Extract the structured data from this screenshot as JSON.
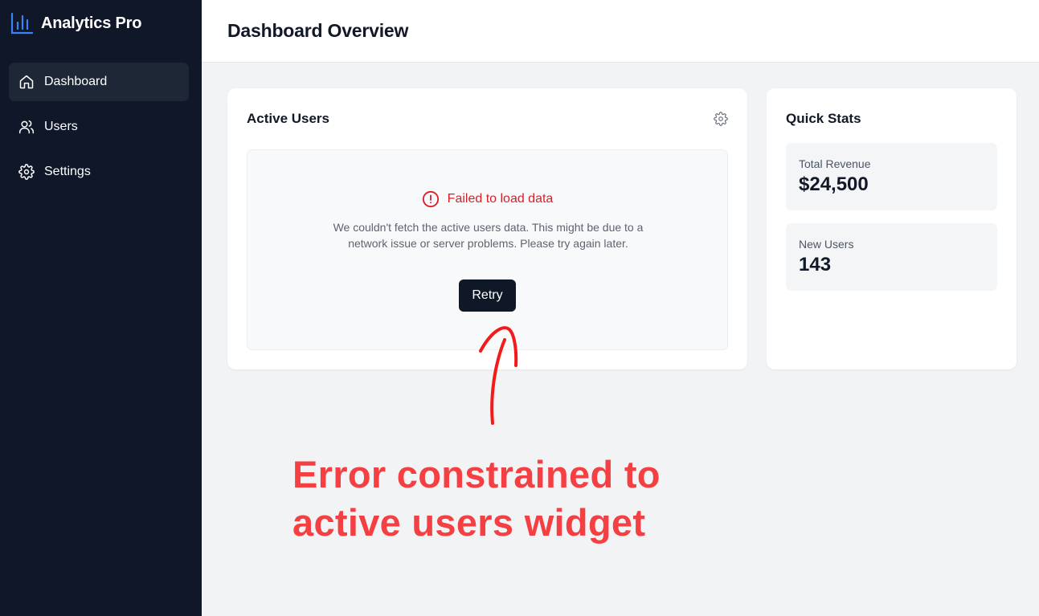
{
  "app": {
    "name": "Analytics Pro",
    "brand_color": "#3b82f6"
  },
  "sidebar": {
    "items": [
      {
        "label": "Dashboard",
        "icon": "home-icon",
        "active": true
      },
      {
        "label": "Users",
        "icon": "users-icon",
        "active": false
      },
      {
        "label": "Settings",
        "icon": "gear-icon",
        "active": false
      }
    ]
  },
  "header": {
    "title": "Dashboard Overview"
  },
  "active_users_widget": {
    "title": "Active Users",
    "settings_icon": "gear-icon",
    "error": {
      "icon": "alert-circle-icon",
      "title": "Failed to load data",
      "message": "We couldn't fetch the active users data. This might be due to a network issue or server problems. Please try again later.",
      "retry_label": "Retry",
      "color": "#d81f26"
    }
  },
  "quick_stats": {
    "title": "Quick Stats",
    "stats": [
      {
        "label": "Total Revenue",
        "value": "$24,500"
      },
      {
        "label": "New Users",
        "value": "143"
      }
    ]
  },
  "annotation": {
    "line1": "Error constrained to",
    "line2": "active users widget",
    "color": "#f43f43"
  }
}
